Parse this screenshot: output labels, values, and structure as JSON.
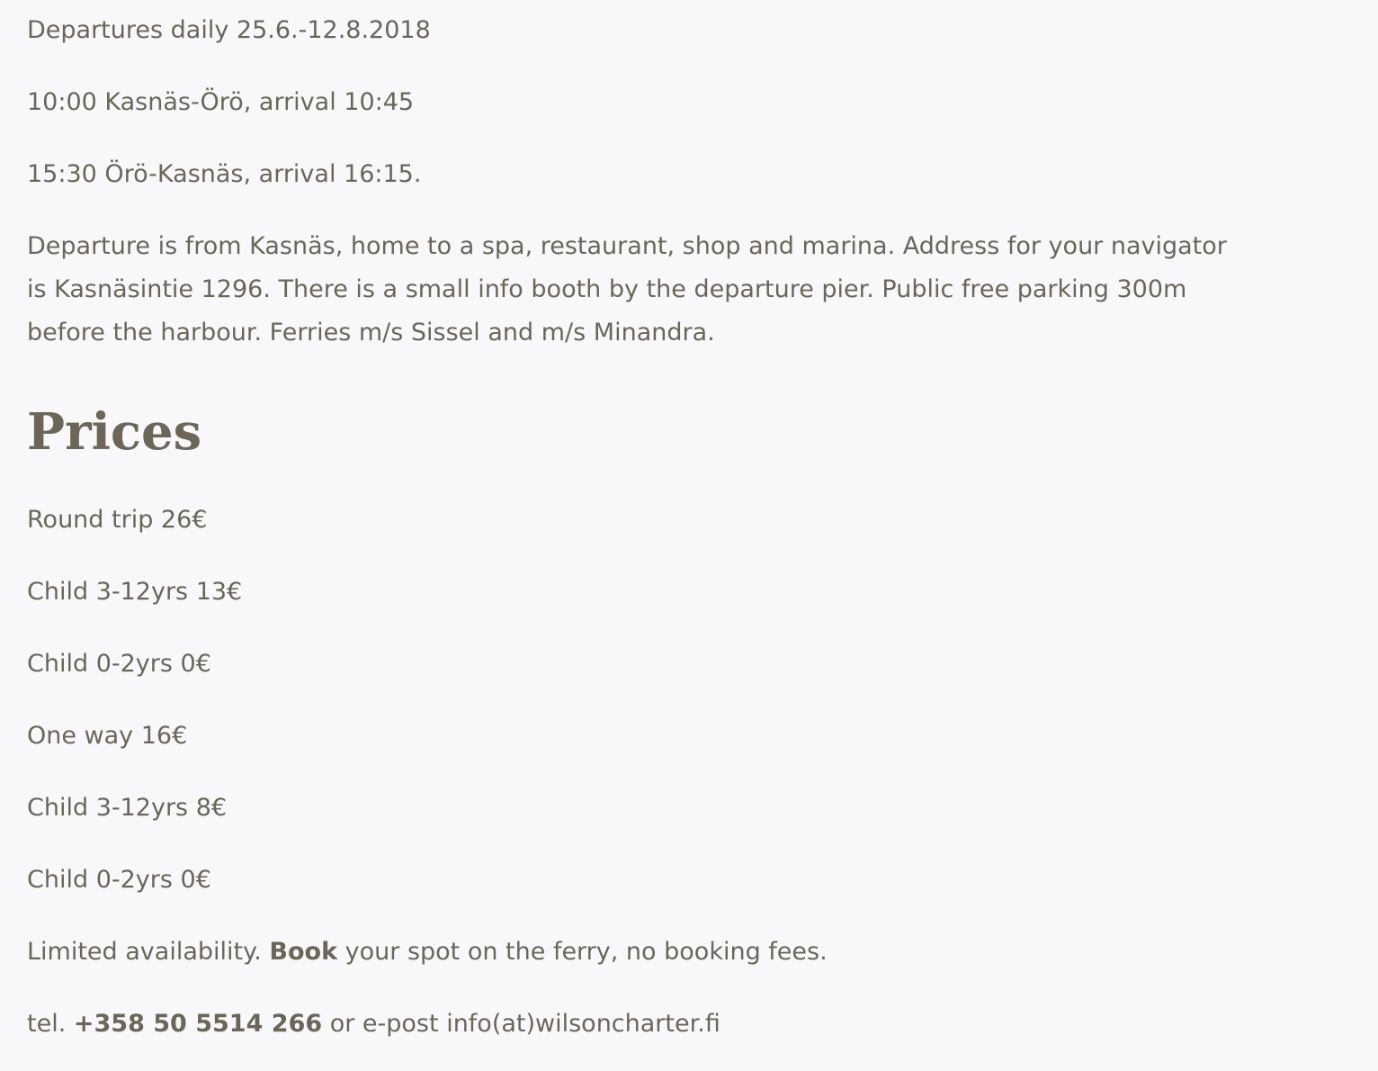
{
  "schedule": {
    "season": "Departures daily 25.6.-12.8.2018",
    "outbound": "10:00 Kasnäs-Örö, arrival 10:45",
    "return": "15:30 Örö-Kasnäs, arrival 16:15.",
    "departure_line1": "Departure is from Kasnäs, home to a spa, restaurant, shop and marina. Address for your navigator",
    "departure_line2": "is Kasnäsintie 1296. There is a small info booth by the departure pier. Public free parking 300m",
    "departure_line3": "before the harbour. Ferries m/s Sissel and m/s Minandra."
  },
  "prices": {
    "heading": "Prices",
    "items": [
      "Round trip 26€",
      "Child 3-12yrs 13€",
      "Child 0-2yrs 0€",
      "One way 16€",
      "Child 3-12yrs 8€",
      "Child 0-2yrs 0€"
    ]
  },
  "booking": {
    "prefix": "Limited availability. ",
    "book_bold": "Book",
    "suffix": " your spot on the ferry, no booking fees."
  },
  "contact": {
    "tel_prefix": "tel. ",
    "phone": "+358 50 5514 266",
    "middle": " or e-post ",
    "email": "info(at)wilsoncharter.fi"
  }
}
